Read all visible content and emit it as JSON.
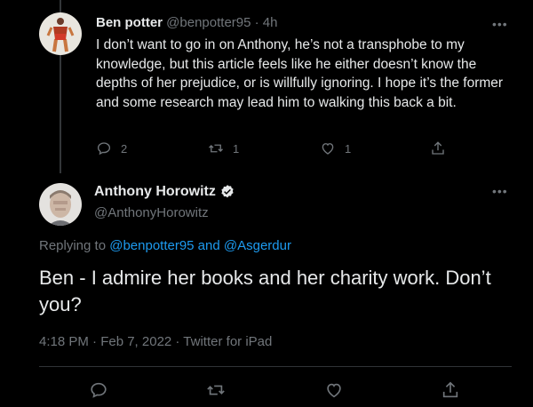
{
  "reply_tweet": {
    "author_name": "Ben potter",
    "handle_and_time": "@benpotter95 · 4h",
    "text": "I don’t want to go in on Anthony, he’s not a transphobe to my knowledge, but this article feels like he either doesn’t know the depths of her prejudice, or is willfully ignoring. I hope it’s the former and some research may lead him to walking this back a bit.",
    "replies": "2",
    "retweets": "1",
    "likes": "1"
  },
  "main_tweet": {
    "author_name": "Anthony Horowitz",
    "handle": "@AnthonyHorowitz",
    "replying_prefix": "Replying to ",
    "replying_user1": "@benpotter95",
    "replying_and": " and ",
    "replying_user2": "@Asgerdur",
    "text": "Ben - I admire her books and her charity work. Don’t you?",
    "timestamp": "4:18 PM · Feb 7, 2022 · Twitter for iPad"
  },
  "icons": {
    "reply": "reply-icon",
    "retweet": "retweet-icon",
    "like": "heart-icon",
    "share": "share-icon",
    "more": "more-icon",
    "verified": "verified-icon"
  },
  "colors": {
    "background": "#000000",
    "text": "#e7e9ea",
    "secondary": "#71767b",
    "accent": "#1d9bf0"
  }
}
